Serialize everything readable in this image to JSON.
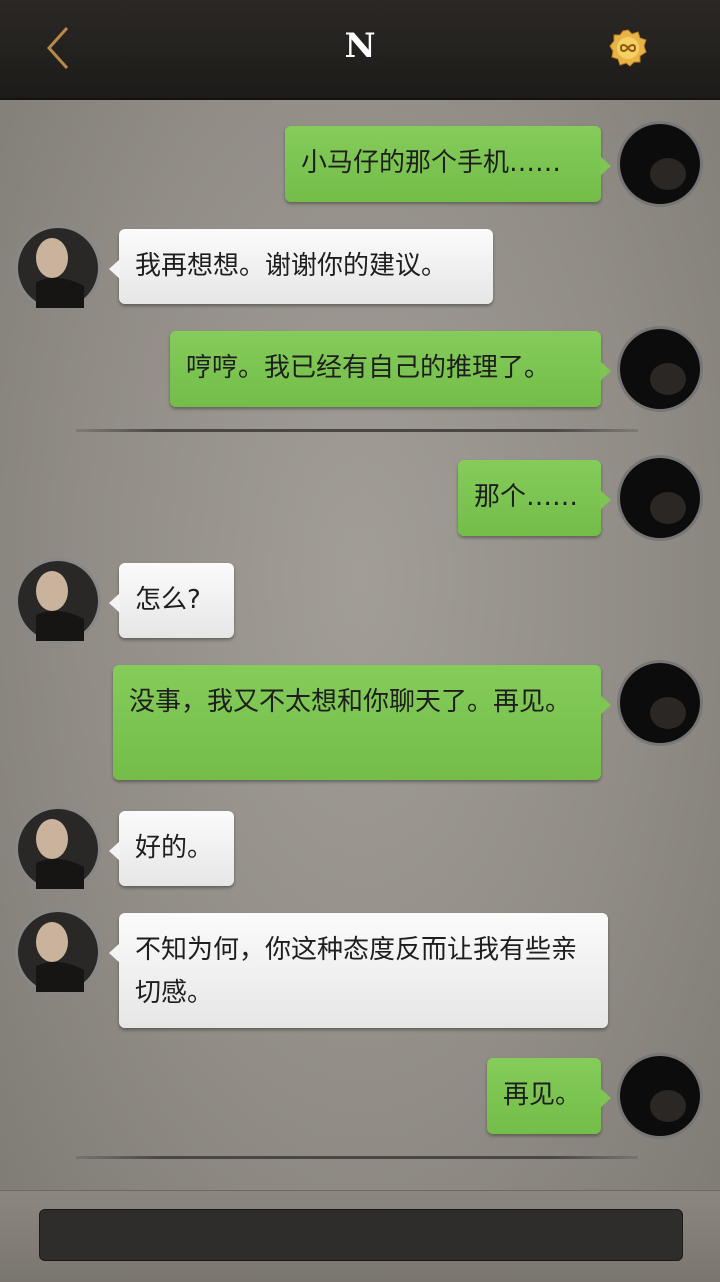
{
  "header": {
    "title": "N",
    "back_icon": "chevron-left-icon",
    "coin_icon": "infinity-coin-icon"
  },
  "messages": [
    {
      "sender": "me",
      "text": "小马仔的那个手机……"
    },
    {
      "sender": "other",
      "text": "我再想想。谢谢你的建议。"
    },
    {
      "sender": "me",
      "text": "哼哼。我已经有自己的推理了。"
    },
    {
      "sender": "me",
      "text": "那个……"
    },
    {
      "sender": "other",
      "text": "怎么?"
    },
    {
      "sender": "me",
      "text": "没事，我又不太想和你聊天了。再见。"
    },
    {
      "sender": "other",
      "text": "好的。"
    },
    {
      "sender": "other",
      "text": "不知为何，你这种态度反而让我有些亲切感。"
    },
    {
      "sender": "me",
      "text": "再见。"
    }
  ],
  "input": {
    "placeholder": ""
  },
  "colors": {
    "my_bubble": "#7cc451",
    "other_bubble": "#f2f2f2",
    "header_bg": "#232120",
    "page_bg": "#918d86"
  }
}
